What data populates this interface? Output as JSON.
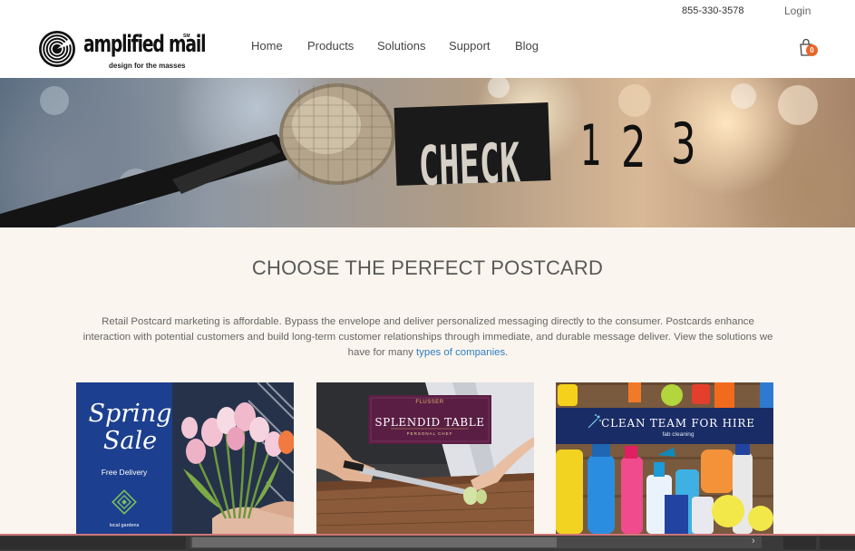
{
  "header": {
    "phone": "855-330-3578",
    "login": "Login",
    "logo": {
      "name": "amplified mail",
      "mark": "SM",
      "tagline": "design for the masses"
    },
    "nav": [
      {
        "label": "Home"
      },
      {
        "label": "Products"
      },
      {
        "label": "Solutions"
      },
      {
        "label": "Support"
      },
      {
        "label": "Blog"
      }
    ],
    "cart": {
      "icon": "shopping-bag-icon",
      "count": "0",
      "badge_color": "#e8652a"
    }
  },
  "hero": {
    "text": "CHECK 1 2 3"
  },
  "main": {
    "headline": "CHOOSE THE PERFECT POSTCARD",
    "intro_text": "Retail Postcard marketing is affordable. Bypass the envelope and deliver personalized messaging directly to the consumer. Postcards enhance interaction with potential customers and build long-term customer relationships through immediate, and durable message deliver. View the solutions we have for many ",
    "intro_link": "types of companies",
    "intro_end": ".",
    "link_color": "#2f7fc1"
  },
  "cards": [
    {
      "title": "Spring Sale",
      "subtitle": "Free Delivery",
      "footer": "local gardens",
      "panel_color": "#1d3f8f"
    },
    {
      "title": "SPLENDID TABLE",
      "small": "FLUSSER",
      "subtitle": "PERSONAL CHEF",
      "banner_color": "#5a1e44"
    },
    {
      "title": "CLEAN TEAM FOR HIRE",
      "subtitle": "fab cleaning",
      "banner_color": "#1a2c66"
    }
  ]
}
